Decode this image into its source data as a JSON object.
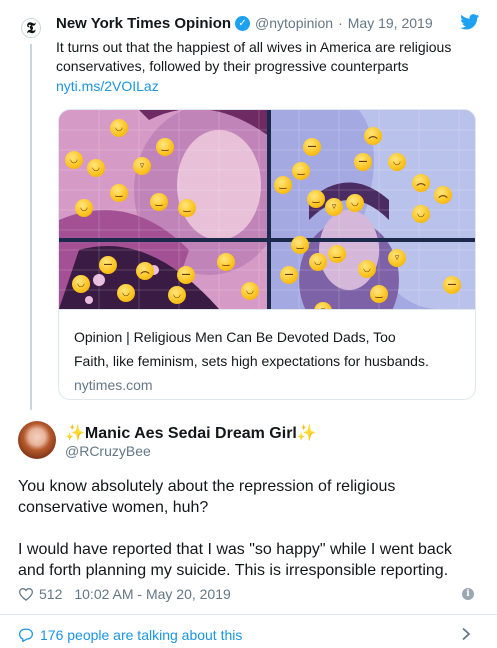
{
  "parent_tweet": {
    "avatar_letter": "𝕿",
    "name": "New York Times Opinion",
    "handle": "@nytopinion",
    "separator": "·",
    "date": "May 19, 2019",
    "text": "It turns out that the happiest of all wives in America are religious conservatives, followed by their progressive counterparts",
    "link": "nyti.ms/2VOILaz",
    "card": {
      "title": "Opinion | Religious Men Can Be Devoted Dads, Too",
      "description": "Faith, like feminism, sets high expectations for husbands.",
      "domain": "nytimes.com"
    }
  },
  "reply_tweet": {
    "sparkle_left": "✨",
    "name": "Manic Aes Sedai Dream Girl",
    "sparkle_right": "✨",
    "handle": "@RCruzyBee",
    "paragraph_1": "You know absolutely about the repression of religious conservative women, huh?",
    "paragraph_2": "I would have reported that I was \"so happy\" while I went back and forth planning my suicide. This is irresponsible reporting.",
    "like_count": "512",
    "timestamp": "10:02 AM - May 20, 2019",
    "info_glyph": "i"
  },
  "footer": {
    "talking": "176 people are talking about this"
  },
  "icons": {
    "verified": "verified-badge-icon",
    "twitter": "twitter-bird-icon",
    "heart": "heart-outline-icon",
    "info": "info-icon",
    "bubble": "speech-bubble-icon",
    "chevron": "chevron-right-icon"
  },
  "colors": {
    "link_blue": "#1b95e0",
    "verified_blue": "#1da1f2",
    "meta_gray": "#657786",
    "divider": "#e1e8ed"
  }
}
